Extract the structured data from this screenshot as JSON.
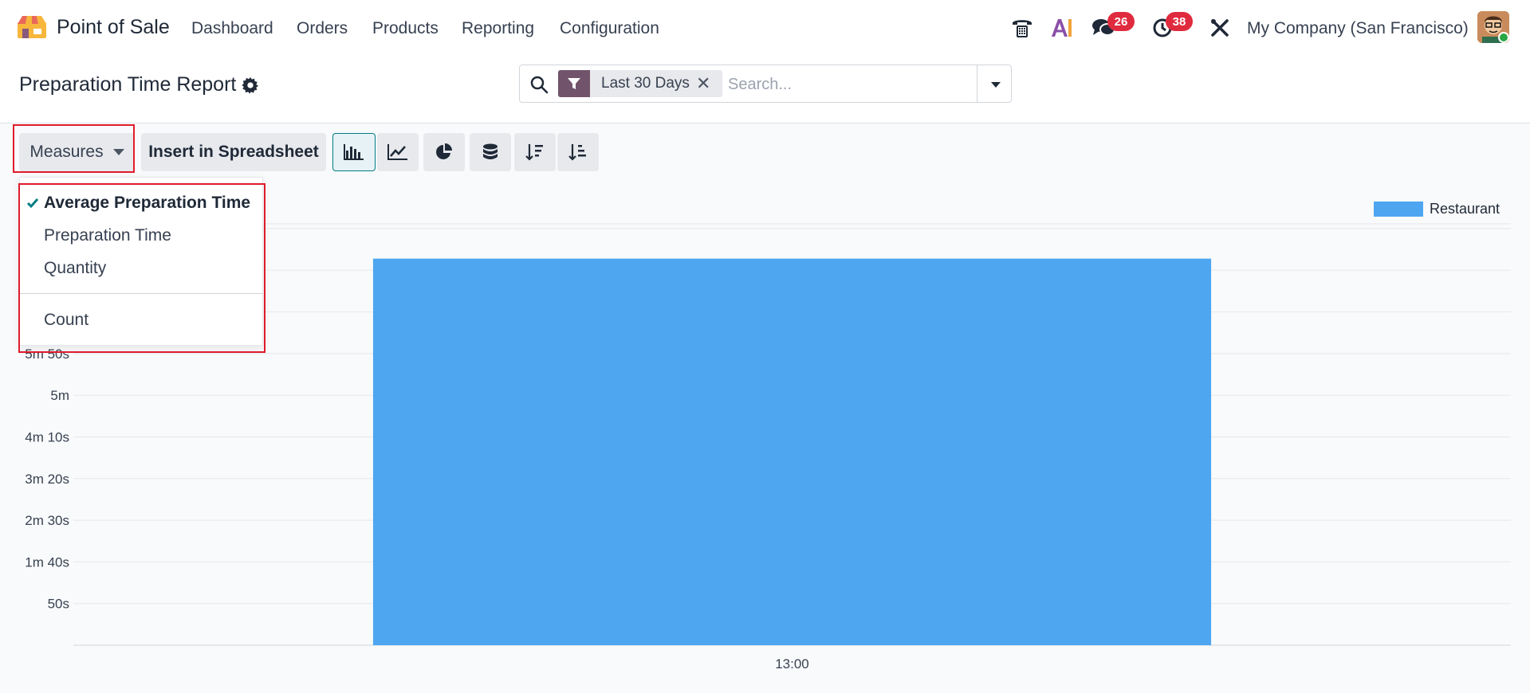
{
  "navbar": {
    "app_name": "Point of Sale",
    "menus": [
      "Dashboard",
      "Orders",
      "Products",
      "Reporting",
      "Configuration"
    ],
    "ai_label": "AI",
    "messages_count": "26",
    "activities_count": "38",
    "company": "My Company (San Francisco)",
    "icons": [
      "app-logo-icon",
      "phone-icon",
      "ai-icon",
      "chat-icon",
      "clock-icon",
      "tools-icon"
    ]
  },
  "control_panel": {
    "title": "Preparation Time Report",
    "search": {
      "facet_icon": "filter-icon",
      "facet_value": "Last 30 Days",
      "placeholder": "Search..."
    }
  },
  "toolbar": {
    "measures_label": "Measures",
    "insert_label": "Insert in Spreadsheet",
    "view_buttons": [
      "bar-chart-icon",
      "line-chart-icon",
      "pie-chart-icon",
      "stack-icon",
      "sort-descending-icon",
      "sort-ascending-icon"
    ],
    "active_view": "bar"
  },
  "measures_dropdown": {
    "items": [
      {
        "label": "Average Preparation Time",
        "checked": true
      },
      {
        "label": "Preparation Time",
        "checked": false
      },
      {
        "label": "Quantity",
        "checked": false
      },
      {
        "label": "Count",
        "checked": false
      }
    ]
  },
  "colors": {
    "bar": "#4ea6f1",
    "brand": "#71546b",
    "badge": "#e02b3e",
    "highlight": "#e01b2b"
  },
  "chart_data": {
    "type": "bar",
    "categories": [
      "13:00"
    ],
    "series": [
      {
        "name": "Restaurant",
        "values": [
          464
        ]
      }
    ],
    "value_unit": "seconds",
    "yticks": [
      {
        "value": 50,
        "label": "50s"
      },
      {
        "value": 100,
        "label": "1m 40s"
      },
      {
        "value": 150,
        "label": "2m 30s"
      },
      {
        "value": 200,
        "label": "3m 20s"
      },
      {
        "value": 250,
        "label": "4m 10s"
      },
      {
        "value": 300,
        "label": "5m"
      },
      {
        "value": 350,
        "label": "5m 50s"
      }
    ],
    "ylim": [
      0,
      500
    ],
    "legend_position": "top-right",
    "grid": true
  }
}
